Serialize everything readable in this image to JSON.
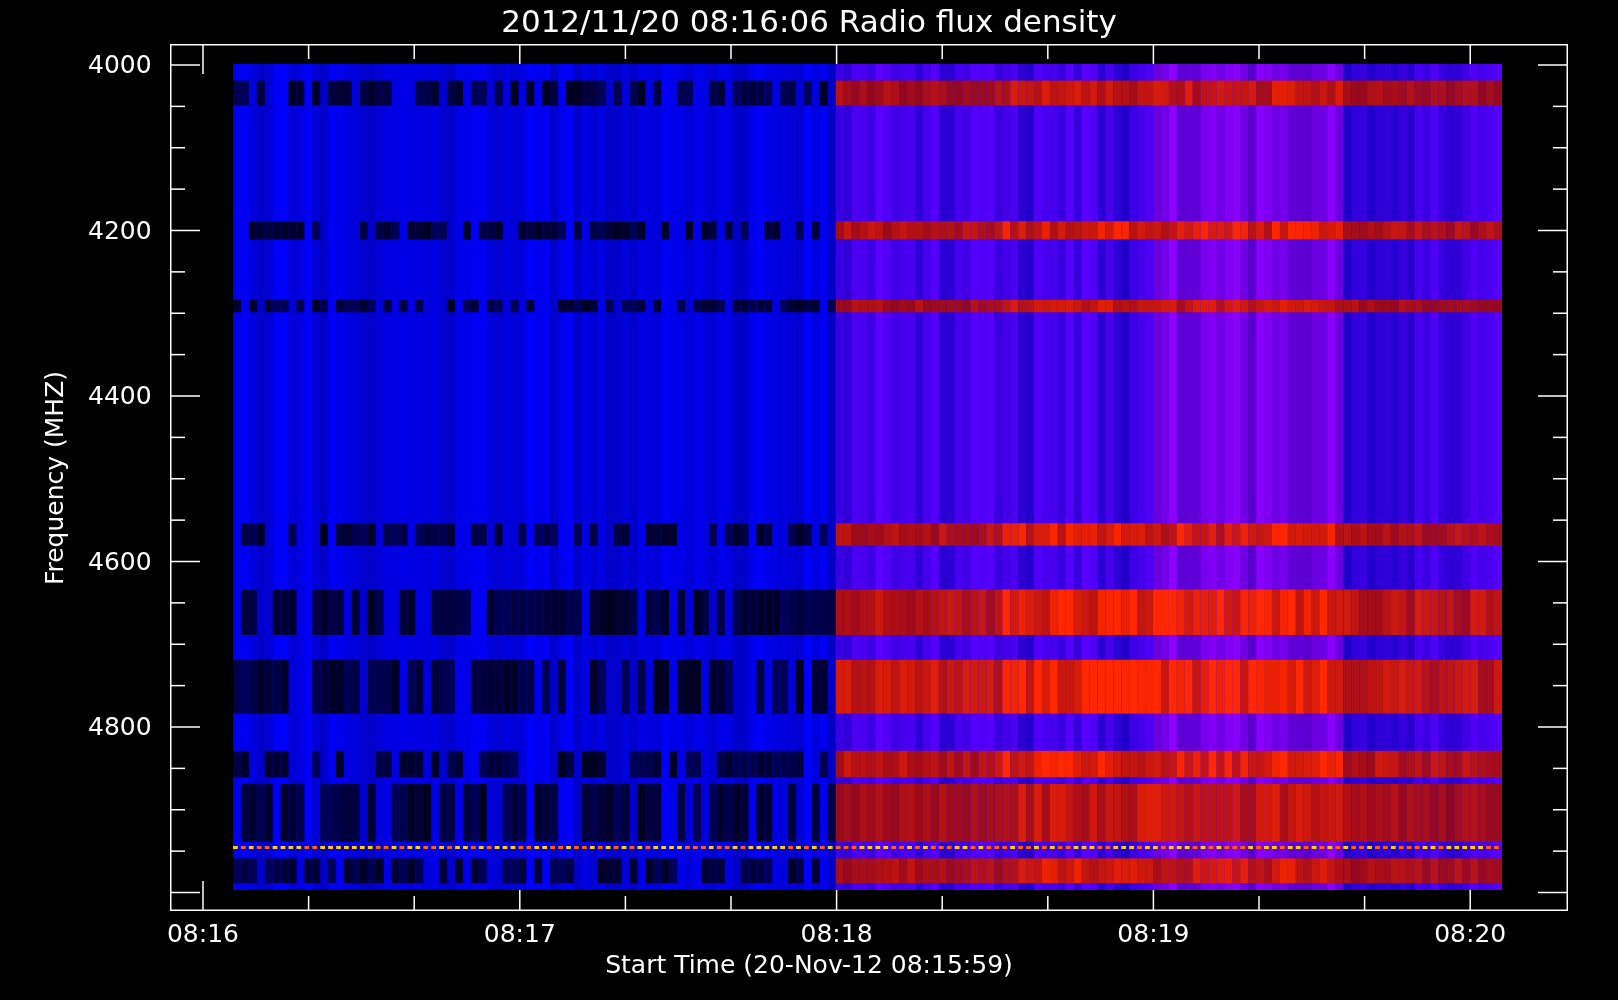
{
  "title": "2012/11/20 08:16:06 Radio flux density",
  "y_axis": {
    "label": "Frequency (MHZ)",
    "ticks": [
      "4000",
      "4200",
      "4400",
      "4600",
      "4800"
    ]
  },
  "x_axis": {
    "label": "Start Time (20-Nov-12 08:15:59)",
    "ticks": [
      "08:16",
      "08:17",
      "08:18",
      "08:19",
      "08:20"
    ]
  }
}
